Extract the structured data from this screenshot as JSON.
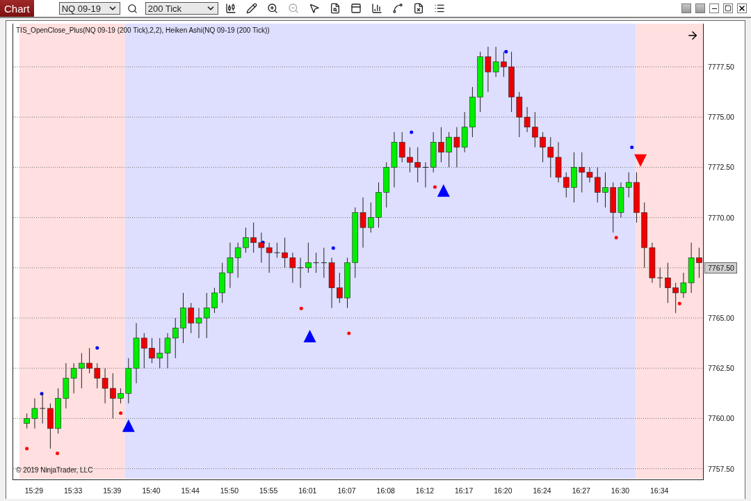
{
  "window": {
    "title": "Chart"
  },
  "toolbar": {
    "instrument": "NQ 09-19",
    "interval": "200 Tick"
  },
  "chart": {
    "indicator_label": "TIS_OpenClose_Plus(NQ 09-19 (200 Tick),2,2), Heiken Ashi(NQ 09-19 (200 Tick))",
    "copyright": "© 2019 NinjaTrader, LLC",
    "current_price": "7767.50",
    "background_zones": [
      {
        "color": "#ffdfdf"
      },
      {
        "color": "#dedeff"
      },
      {
        "color": "#ffdfdf"
      }
    ],
    "chart_data": {
      "type": "candlestick",
      "ylim": [
        7757,
        7779.65
      ],
      "grid": true,
      "categories": [
        null,
        "15:29",
        null,
        null,
        null,
        null,
        "15:33",
        null,
        null,
        null,
        null,
        "15:39",
        null,
        null,
        null,
        null,
        "15:40",
        null,
        null,
        null,
        null,
        "15:44",
        null,
        null,
        null,
        null,
        "15:50",
        null,
        null,
        null,
        null,
        "15:55",
        null,
        null,
        null,
        null,
        "16:01",
        null,
        null,
        null,
        null,
        "16:07",
        null,
        null,
        null,
        null,
        "16:08",
        null,
        null,
        null,
        null,
        "16:12",
        null,
        null,
        null,
        null,
        "16:17",
        null,
        null,
        null,
        null,
        "16:20",
        null,
        null,
        null,
        null,
        "16:24",
        null,
        null,
        null,
        null,
        "16:27",
        null,
        null,
        null,
        null,
        "16:30",
        null,
        null,
        null,
        null,
        "16:34",
        null,
        null,
        null,
        null,
        null
      ],
      "ohlc": [
        [
          7759.75,
          7760.25,
          7759.5,
          7760
        ],
        [
          7760,
          7761,
          7759.5,
          7760.5
        ],
        [
          7760.5,
          7761.25,
          7759.75,
          7760.5
        ],
        [
          7760.5,
          7760.75,
          7758.5,
          7759.5
        ],
        [
          7759.5,
          7761.5,
          7759.25,
          7761
        ],
        [
          7761,
          7762.75,
          7760.5,
          7762
        ],
        [
          7762,
          7762.75,
          7761.25,
          7762.5
        ],
        [
          7762.5,
          7763.25,
          7761.5,
          7762.75
        ],
        [
          7762.75,
          7763.5,
          7762.25,
          7762.5
        ],
        [
          7762.5,
          7762.75,
          7761.5,
          7762
        ],
        [
          7762,
          7762.5,
          7760.75,
          7761.5
        ],
        [
          7761.5,
          7762.25,
          7760,
          7761
        ],
        [
          7761,
          7761.5,
          7760.75,
          7761.25
        ],
        [
          7761.25,
          7763,
          7760.75,
          7762.5
        ],
        [
          7762.5,
          7764.75,
          7761.75,
          7764
        ],
        [
          7764,
          7764.25,
          7762.5,
          7763.5
        ],
        [
          7763.5,
          7764,
          7762.75,
          7763
        ],
        [
          7763,
          7764,
          7762.5,
          7763.25
        ],
        [
          7763.25,
          7764.25,
          7762.5,
          7764
        ],
        [
          7764,
          7765,
          7763,
          7764.5
        ],
        [
          7764.5,
          7766.25,
          7763.75,
          7765.5
        ],
        [
          7765.5,
          7765.75,
          7764.25,
          7764.75
        ],
        [
          7764.75,
          7765.5,
          7764,
          7765
        ],
        [
          7765,
          7766.25,
          7764,
          7765.5
        ],
        [
          7765.5,
          7766.5,
          7765.25,
          7766.25
        ],
        [
          7766.25,
          7767.75,
          7765.75,
          7767.25
        ],
        [
          7767.25,
          7768.75,
          7766.5,
          7768
        ],
        [
          7768,
          7768.75,
          7767,
          7768.5
        ],
        [
          7768.5,
          7769.5,
          7768.25,
          7769
        ],
        [
          7769,
          7769.75,
          7768.25,
          7768.75
        ],
        [
          7768.75,
          7769.25,
          7767.75,
          7768.5
        ],
        [
          7768.5,
          7768.75,
          7767.25,
          7768.25
        ],
        [
          7768.25,
          7768.75,
          7768,
          7768.25
        ],
        [
          7768.25,
          7769,
          7767.5,
          7768
        ],
        [
          7768,
          7768.25,
          7766.75,
          7767.5
        ],
        [
          7767.5,
          7768,
          7766.5,
          7767.5
        ],
        [
          7767.5,
          7768.75,
          7767.25,
          7767.75
        ],
        [
          7767.75,
          7768.25,
          7767.25,
          7767.75
        ],
        [
          7767.75,
          7768.5,
          7767,
          7767.75
        ],
        [
          7767.75,
          7768,
          7765.5,
          7766.5
        ],
        [
          7766.5,
          7767.25,
          7765.75,
          7766
        ],
        [
          7766,
          7768,
          7765.5,
          7767.75
        ],
        [
          7767.75,
          7770.5,
          7767,
          7770.25
        ],
        [
          7770.25,
          7771,
          7768.5,
          7769.5
        ],
        [
          7769.5,
          7770.75,
          7769.25,
          7770
        ],
        [
          7770,
          7771.75,
          7769.5,
          7771.25
        ],
        [
          7771.25,
          7772.75,
          7770.5,
          7772.5
        ],
        [
          7772.5,
          7774.25,
          7771.5,
          7773.75
        ],
        [
          7773.75,
          7774.25,
          7772.75,
          7773
        ],
        [
          7773,
          7773.5,
          7772.25,
          7772.75
        ],
        [
          7772.75,
          7773.5,
          7771.75,
          7772.5
        ],
        [
          7772.5,
          7772.75,
          7771.5,
          7772.5
        ],
        [
          7772.5,
          7774.25,
          7772.25,
          7773.75
        ],
        [
          7773.75,
          7774.5,
          7772.75,
          7773.25
        ],
        [
          7773.25,
          7774.25,
          7772.5,
          7774
        ],
        [
          7774,
          7774.5,
          7772.5,
          7773.5
        ],
        [
          7773.5,
          7775.25,
          7773.25,
          7774.5
        ],
        [
          7774.5,
          7776.5,
          7774,
          7776
        ],
        [
          7776,
          7778.25,
          7775.25,
          7778
        ],
        [
          7778,
          7778.5,
          7776.25,
          7777.25
        ],
        [
          7777.25,
          7778.5,
          7777,
          7777.75
        ],
        [
          7777.75,
          7778.25,
          7777,
          7777.5
        ],
        [
          7777.5,
          7778.25,
          7775.25,
          7776
        ],
        [
          7776,
          7776.25,
          7774,
          7775
        ],
        [
          7775,
          7775.5,
          7774.25,
          7774.5
        ],
        [
          7774.5,
          7775.25,
          7773.5,
          7774
        ],
        [
          7774,
          7774.25,
          7772.75,
          7773.5
        ],
        [
          7773.5,
          7774,
          7772,
          7773
        ],
        [
          7773,
          7773.75,
          7771.75,
          7772
        ],
        [
          7772,
          7772.25,
          7771,
          7771.5
        ],
        [
          7771.5,
          7773.25,
          7770.75,
          7772.5
        ],
        [
          7772.5,
          7773.25,
          7771.25,
          7772.25
        ],
        [
          7772.25,
          7772.5,
          7771.75,
          7772
        ],
        [
          7772,
          7772.5,
          7770.75,
          7771.25
        ],
        [
          7771.25,
          7772.25,
          7770.5,
          7771.5
        ],
        [
          7771.5,
          7771.75,
          7769.25,
          7770.25
        ],
        [
          7770.25,
          7771.75,
          7770,
          7771.5
        ],
        [
          7771.5,
          7772.25,
          7771,
          7771.75
        ],
        [
          7771.75,
          7772.25,
          7769.75,
          7770.25
        ],
        [
          7770.25,
          7770.75,
          7767.5,
          7768.5
        ],
        [
          7768.5,
          7768.75,
          7766.75,
          7767
        ],
        [
          7767,
          7767.5,
          7766.5,
          7767
        ],
        [
          7767,
          7767.75,
          7765.75,
          7766.5
        ],
        [
          7766.5,
          7766.75,
          7765.25,
          7766.25
        ],
        [
          7766.25,
          7767.25,
          7766,
          7766.75
        ],
        [
          7766.75,
          7768.75,
          7766.25,
          7768
        ],
        [
          7768,
          7768.5,
          7767,
          7767.75
        ]
      ],
      "yticks": [
        {
          "value": 7777.5,
          "label": "7777.50"
        },
        {
          "value": 7775,
          "label": "7775.00"
        },
        {
          "value": 7772.5,
          "label": "7772.50"
        },
        {
          "value": 7770,
          "label": "7770.00"
        },
        {
          "value": 7765,
          "label": "7765.00"
        },
        {
          "value": 7762.5,
          "label": "7762.50"
        },
        {
          "value": 7760,
          "label": "7760.00"
        },
        {
          "value": 7757.5,
          "label": "7757.50"
        }
      ]
    }
  }
}
